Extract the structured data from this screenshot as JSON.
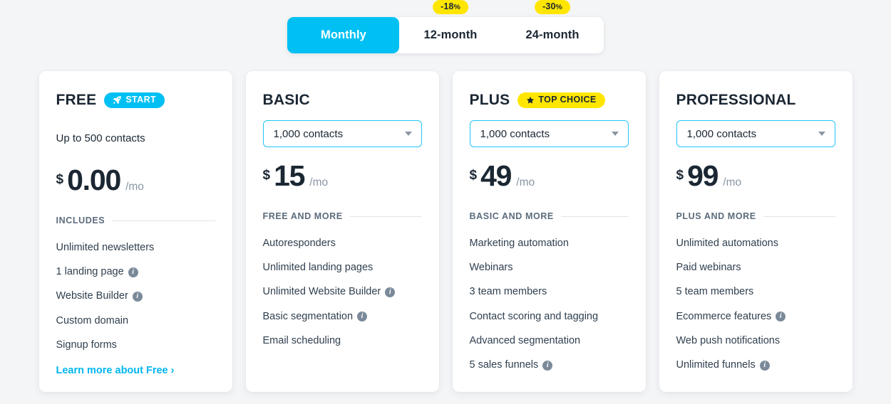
{
  "billing_toggle": {
    "options": [
      {
        "label": "Monthly",
        "active": true,
        "badge": null,
        "badge_pct": null
      },
      {
        "label": "12-month",
        "active": false,
        "badge": "-18",
        "badge_pct": "%"
      },
      {
        "label": "24-month",
        "active": false,
        "badge": "-30",
        "badge_pct": "%"
      }
    ]
  },
  "colors": {
    "accent_cyan": "#00c0f3",
    "badge_yellow": "#ffe600",
    "text_dark": "#1b2733",
    "text_muted": "#8a96a3",
    "page_bg": "#f4f5f7",
    "select_border": "#22c5f5"
  },
  "plans": [
    {
      "name": "FREE",
      "tag": {
        "label": "START",
        "icon": "rocket-icon",
        "style": "start"
      },
      "contacts_text": "Up to 500 contacts",
      "has_select": false,
      "select_value": null,
      "currency": "$",
      "amount": "0.00",
      "period": "/mo",
      "section_label": "INCLUDES",
      "features": [
        {
          "label": "Unlimited newsletters",
          "info": false
        },
        {
          "label": "1 landing page",
          "info": true
        },
        {
          "label": "Website Builder",
          "info": true
        },
        {
          "label": "Custom domain",
          "info": false
        },
        {
          "label": "Signup forms",
          "info": false
        }
      ],
      "learn_more": "Learn more about Free ›"
    },
    {
      "name": "BASIC",
      "tag": null,
      "contacts_text": null,
      "has_select": true,
      "select_value": "1,000 contacts",
      "currency": "$",
      "amount": "15",
      "period": "/mo",
      "section_label": "FREE AND MORE",
      "features": [
        {
          "label": "Autoresponders",
          "info": false
        },
        {
          "label": "Unlimited landing pages",
          "info": false
        },
        {
          "label": "Unlimited Website Builder",
          "info": true
        },
        {
          "label": "Basic segmentation",
          "info": true
        },
        {
          "label": "Email scheduling",
          "info": false
        }
      ],
      "learn_more": null
    },
    {
      "name": "PLUS",
      "tag": {
        "label": "TOP CHOICE",
        "icon": "star-icon",
        "style": "top"
      },
      "contacts_text": null,
      "has_select": true,
      "select_value": "1,000 contacts",
      "currency": "$",
      "amount": "49",
      "period": "/mo",
      "section_label": "BASIC AND MORE",
      "features": [
        {
          "label": "Marketing automation",
          "info": false
        },
        {
          "label": "Webinars",
          "info": false
        },
        {
          "label": "3 team members",
          "info": false
        },
        {
          "label": "Contact scoring and tagging",
          "info": false
        },
        {
          "label": "Advanced segmentation",
          "info": false
        },
        {
          "label": "5 sales funnels",
          "info": true
        }
      ],
      "learn_more": null
    },
    {
      "name": "PROFESSIONAL",
      "tag": null,
      "contacts_text": null,
      "has_select": true,
      "select_value": "1,000 contacts",
      "currency": "$",
      "amount": "99",
      "period": "/mo",
      "section_label": "PLUS AND MORE",
      "features": [
        {
          "label": "Unlimited automations",
          "info": false
        },
        {
          "label": "Paid webinars",
          "info": false
        },
        {
          "label": "5 team members",
          "info": false
        },
        {
          "label": "Ecommerce features",
          "info": true
        },
        {
          "label": "Web push notifications",
          "info": false
        },
        {
          "label": "Unlimited funnels",
          "info": true
        }
      ],
      "learn_more": null
    }
  ]
}
